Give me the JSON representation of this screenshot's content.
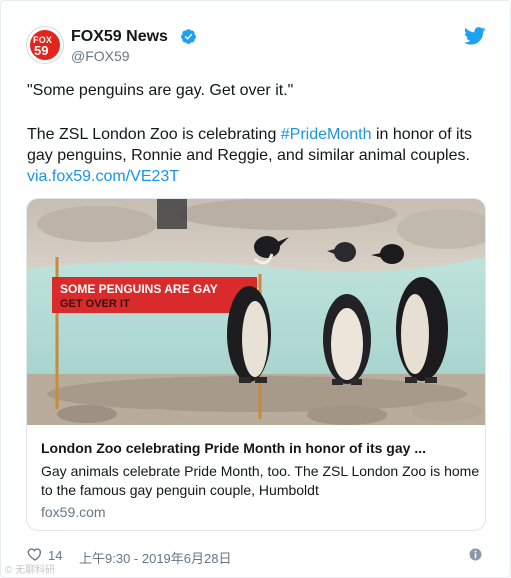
{
  "tweet": {
    "display_name": "FOX59 News",
    "handle": "@FOX59",
    "avatar_text_top": "FOX",
    "avatar_text_bottom": "59",
    "line1": "\"Some penguins are gay. Get over it.\"",
    "line2_before": "The ZSL London Zoo is celebrating ",
    "hashtag": "#PrideMonth",
    "line2_after": " in honor of its gay penguins, Ronnie and Reggie, and similar animal couples. ",
    "link": "via.fox59.com/VE23T"
  },
  "card": {
    "banner_line1": "SOME PENGUINS ARE GAY",
    "banner_line2": "GET OVER IT",
    "title": "London Zoo celebrating Pride Month in honor of its gay ...",
    "description": "Gay animals celebrate Pride Month, too. The ZSL London Zoo is home to the famous gay penguin couple, Humboldt",
    "domain": "fox59.com"
  },
  "footer": {
    "likes": "14",
    "timestamp": "上午9:30 - 2019年6月28日"
  },
  "watermark": "©  无聊科研",
  "colors": {
    "link": "#1b95e0",
    "verified": "#1da1f2",
    "fox_red": "#e2241d",
    "banner_red": "#d92b2b"
  },
  "icons": [
    "verified-badge-icon",
    "twitter-bird-icon",
    "heart-icon",
    "info-icon"
  ]
}
